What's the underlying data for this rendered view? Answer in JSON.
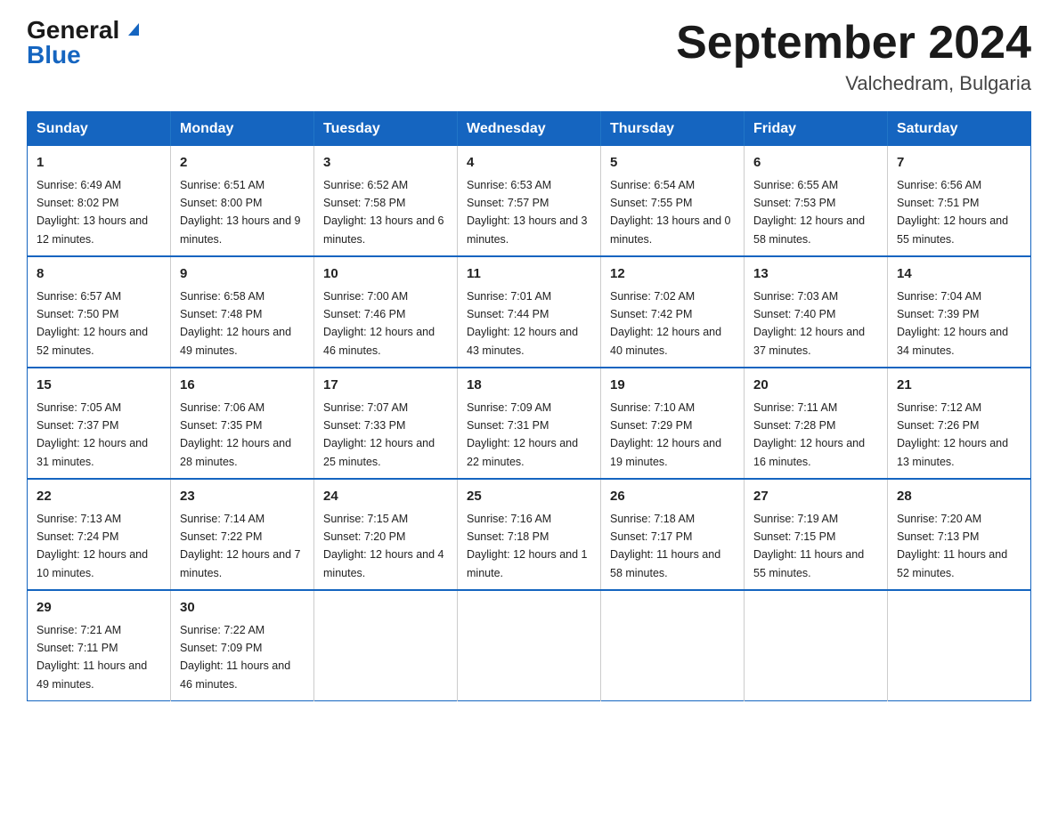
{
  "logo": {
    "general": "General",
    "triangle": "▶",
    "blue": "Blue"
  },
  "header": {
    "month_year": "September 2024",
    "location": "Valchedram, Bulgaria"
  },
  "weekdays": [
    "Sunday",
    "Monday",
    "Tuesday",
    "Wednesday",
    "Thursday",
    "Friday",
    "Saturday"
  ],
  "weeks": [
    [
      {
        "day": "1",
        "sunrise": "6:49 AM",
        "sunset": "8:02 PM",
        "daylight": "13 hours and 12 minutes."
      },
      {
        "day": "2",
        "sunrise": "6:51 AM",
        "sunset": "8:00 PM",
        "daylight": "13 hours and 9 minutes."
      },
      {
        "day": "3",
        "sunrise": "6:52 AM",
        "sunset": "7:58 PM",
        "daylight": "13 hours and 6 minutes."
      },
      {
        "day": "4",
        "sunrise": "6:53 AM",
        "sunset": "7:57 PM",
        "daylight": "13 hours and 3 minutes."
      },
      {
        "day": "5",
        "sunrise": "6:54 AM",
        "sunset": "7:55 PM",
        "daylight": "13 hours and 0 minutes."
      },
      {
        "day": "6",
        "sunrise": "6:55 AM",
        "sunset": "7:53 PM",
        "daylight": "12 hours and 58 minutes."
      },
      {
        "day": "7",
        "sunrise": "6:56 AM",
        "sunset": "7:51 PM",
        "daylight": "12 hours and 55 minutes."
      }
    ],
    [
      {
        "day": "8",
        "sunrise": "6:57 AM",
        "sunset": "7:50 PM",
        "daylight": "12 hours and 52 minutes."
      },
      {
        "day": "9",
        "sunrise": "6:58 AM",
        "sunset": "7:48 PM",
        "daylight": "12 hours and 49 minutes."
      },
      {
        "day": "10",
        "sunrise": "7:00 AM",
        "sunset": "7:46 PM",
        "daylight": "12 hours and 46 minutes."
      },
      {
        "day": "11",
        "sunrise": "7:01 AM",
        "sunset": "7:44 PM",
        "daylight": "12 hours and 43 minutes."
      },
      {
        "day": "12",
        "sunrise": "7:02 AM",
        "sunset": "7:42 PM",
        "daylight": "12 hours and 40 minutes."
      },
      {
        "day": "13",
        "sunrise": "7:03 AM",
        "sunset": "7:40 PM",
        "daylight": "12 hours and 37 minutes."
      },
      {
        "day": "14",
        "sunrise": "7:04 AM",
        "sunset": "7:39 PM",
        "daylight": "12 hours and 34 minutes."
      }
    ],
    [
      {
        "day": "15",
        "sunrise": "7:05 AM",
        "sunset": "7:37 PM",
        "daylight": "12 hours and 31 minutes."
      },
      {
        "day": "16",
        "sunrise": "7:06 AM",
        "sunset": "7:35 PM",
        "daylight": "12 hours and 28 minutes."
      },
      {
        "day": "17",
        "sunrise": "7:07 AM",
        "sunset": "7:33 PM",
        "daylight": "12 hours and 25 minutes."
      },
      {
        "day": "18",
        "sunrise": "7:09 AM",
        "sunset": "7:31 PM",
        "daylight": "12 hours and 22 minutes."
      },
      {
        "day": "19",
        "sunrise": "7:10 AM",
        "sunset": "7:29 PM",
        "daylight": "12 hours and 19 minutes."
      },
      {
        "day": "20",
        "sunrise": "7:11 AM",
        "sunset": "7:28 PM",
        "daylight": "12 hours and 16 minutes."
      },
      {
        "day": "21",
        "sunrise": "7:12 AM",
        "sunset": "7:26 PM",
        "daylight": "12 hours and 13 minutes."
      }
    ],
    [
      {
        "day": "22",
        "sunrise": "7:13 AM",
        "sunset": "7:24 PM",
        "daylight": "12 hours and 10 minutes."
      },
      {
        "day": "23",
        "sunrise": "7:14 AM",
        "sunset": "7:22 PM",
        "daylight": "12 hours and 7 minutes."
      },
      {
        "day": "24",
        "sunrise": "7:15 AM",
        "sunset": "7:20 PM",
        "daylight": "12 hours and 4 minutes."
      },
      {
        "day": "25",
        "sunrise": "7:16 AM",
        "sunset": "7:18 PM",
        "daylight": "12 hours and 1 minute."
      },
      {
        "day": "26",
        "sunrise": "7:18 AM",
        "sunset": "7:17 PM",
        "daylight": "11 hours and 58 minutes."
      },
      {
        "day": "27",
        "sunrise": "7:19 AM",
        "sunset": "7:15 PM",
        "daylight": "11 hours and 55 minutes."
      },
      {
        "day": "28",
        "sunrise": "7:20 AM",
        "sunset": "7:13 PM",
        "daylight": "11 hours and 52 minutes."
      }
    ],
    [
      {
        "day": "29",
        "sunrise": "7:21 AM",
        "sunset": "7:11 PM",
        "daylight": "11 hours and 49 minutes."
      },
      {
        "day": "30",
        "sunrise": "7:22 AM",
        "sunset": "7:09 PM",
        "daylight": "11 hours and 46 minutes."
      },
      null,
      null,
      null,
      null,
      null
    ]
  ]
}
